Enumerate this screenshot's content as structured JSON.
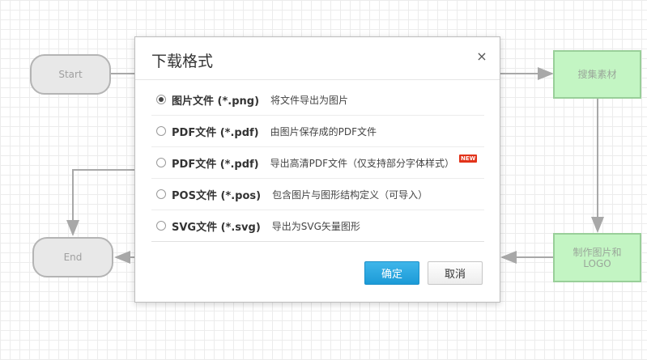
{
  "flowchart": {
    "start_label": "Start",
    "end_label": "End",
    "node_gather": "搜集素材",
    "node_make": "制作图片和LOGO"
  },
  "dialog": {
    "title": "下载格式",
    "close_symbol": "×",
    "options": [
      {
        "name": "图片文件 (*.png)",
        "description": "将文件导出为图片",
        "selected": true,
        "is_new": false
      },
      {
        "name": "PDF文件 (*.pdf)",
        "description": "由图片保存成的PDF文件",
        "selected": false,
        "is_new": false
      },
      {
        "name": "PDF文件 (*.pdf)",
        "description": "导出高清PDF文件（仅支持部分字体样式）",
        "selected": false,
        "is_new": true
      },
      {
        "name": "POS文件 (*.pos)",
        "description": "包含图片与图形结构定义（可导入）",
        "selected": false,
        "is_new": false
      },
      {
        "name": "SVG文件 (*.svg)",
        "description": "导出为SVG矢量图形",
        "selected": false,
        "is_new": false
      }
    ],
    "new_badge": "NEW",
    "ok_label": "确定",
    "cancel_label": "取消"
  },
  "colors": {
    "process_fill": "#c3f5c3",
    "terminal_fill": "#e8e8e8",
    "ok_button": "#1c9bd7"
  }
}
